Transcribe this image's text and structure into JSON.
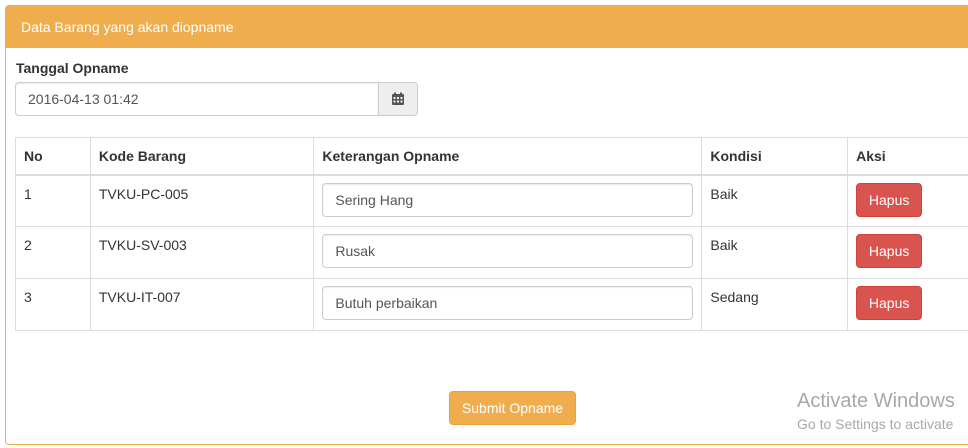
{
  "panel": {
    "heading": "Data Barang yang akan diopname",
    "accent_color": "#f0ad4e"
  },
  "form": {
    "date_label": "Tanggal Opname",
    "date_value": "2016-04-13 01:42",
    "calendar_icon": "calendar-icon"
  },
  "table": {
    "headers": [
      "No",
      "Kode Barang",
      "Keterangan Opname",
      "Kondisi",
      "Aksi"
    ],
    "rows": [
      {
        "no": "1",
        "kode": "TVKU-PC-005",
        "keterangan": "Sering Hang",
        "kondisi": "Baik",
        "aksi": "Hapus"
      },
      {
        "no": "2",
        "kode": "TVKU-SV-003",
        "keterangan": "Rusak",
        "kondisi": "Baik",
        "aksi": "Hapus"
      },
      {
        "no": "3",
        "kode": "TVKU-IT-007",
        "keterangan": "Butuh perbaikan",
        "kondisi": "Sedang",
        "aksi": "Hapus"
      }
    ],
    "delete_color": "#d9534f"
  },
  "submit_label": "Submit Opname",
  "watermark": {
    "title": "Activate Windows",
    "subtitle": "Go to Settings to activate"
  }
}
